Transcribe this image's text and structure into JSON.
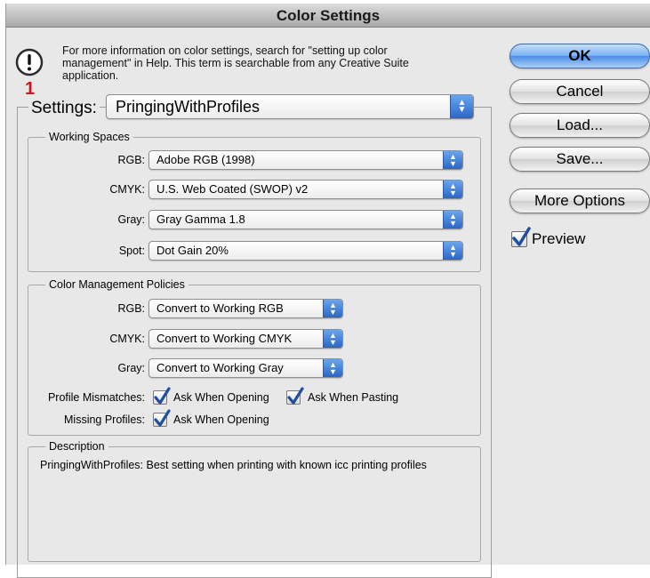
{
  "window": {
    "title": "Color Settings"
  },
  "info": {
    "message": "For more information on color settings, search for \"setting up color management\" in Help. This term is searchable from any Creative Suite application."
  },
  "marker": "1",
  "settings": {
    "label": "Settings:",
    "value": "PringingWithProfiles"
  },
  "working_spaces": {
    "title": "Working Spaces",
    "rgb": {
      "label": "RGB:",
      "value": "Adobe RGB (1998)"
    },
    "cmyk": {
      "label": "CMYK:",
      "value": "U.S. Web Coated (SWOP) v2"
    },
    "gray": {
      "label": "Gray:",
      "value": "Gray Gamma 1.8"
    },
    "spot": {
      "label": "Spot:",
      "value": "Dot Gain 20%"
    }
  },
  "policies": {
    "title": "Color Management Policies",
    "rgb": {
      "label": "RGB:",
      "value": "Convert to Working RGB"
    },
    "cmyk": {
      "label": "CMYK:",
      "value": "Convert to Working CMYK"
    },
    "gray": {
      "label": "Gray:",
      "value": "Convert to Working Gray"
    },
    "profile_mismatches": {
      "label": "Profile Mismatches:",
      "ask_opening": {
        "label": "Ask When Opening",
        "checked": true
      },
      "ask_pasting": {
        "label": "Ask When Pasting",
        "checked": true
      }
    },
    "missing_profiles": {
      "label": "Missing Profiles:",
      "ask_opening": {
        "label": "Ask When Opening",
        "checked": true
      }
    }
  },
  "description": {
    "title": "Description",
    "text": "PringingWithProfiles:  Best setting when printing with known icc printing profiles"
  },
  "buttons": {
    "ok": "OK",
    "cancel": "Cancel",
    "load": "Load...",
    "save": "Save...",
    "more_options": "More Options"
  },
  "preview": {
    "label": "Preview",
    "checked": true
  },
  "colors": {
    "accent": "#3a7fe0",
    "marker": "#d0141b",
    "background": "#e8e8e8"
  },
  "icons": {
    "alert": "exclamation-alert-icon",
    "popup_arrows": "up-down-arrows-icon",
    "check": "checkmark-icon"
  }
}
